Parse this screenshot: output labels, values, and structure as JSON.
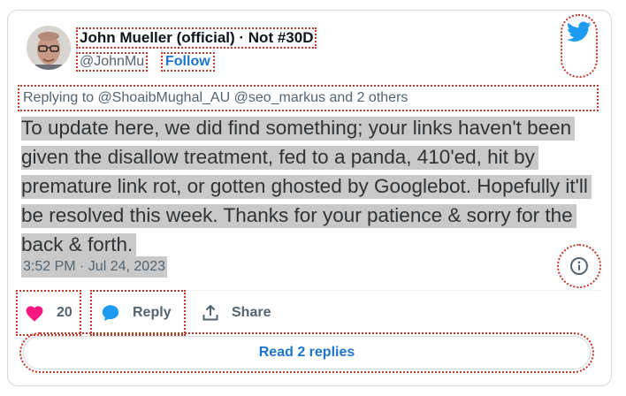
{
  "tweet": {
    "author_name": "John Mueller (official) · Not #30D",
    "handle": "@JohnMu",
    "follow_label": "Follow",
    "replying_to": "Replying to @ShoaibMughal_AU @seo_markus and 2 others",
    "text": "To update here, we did find something; your links haven't been given the disallow treatment, fed to a panda, 410'ed, hit by premature link rot, or gotten ghosted by Googlebot. Hopefully it'll be resolved this week. Thanks for your patience & sorry for the back & forth.",
    "timestamp": "3:52 PM · Jul 24, 2023"
  },
  "actions": {
    "like_count": "20",
    "reply_label": "Reply",
    "share_label": "Share",
    "read_replies_label": "Read 2 replies"
  },
  "icons": {
    "brand": "twitter-bird-icon",
    "info": "info-icon",
    "like": "heart-icon",
    "reply": "speech-bubble-icon",
    "share": "share-upload-icon"
  },
  "colors": {
    "twitter_blue": "#1d9bf0",
    "link_blue": "#1d74d0",
    "like_pink": "#f91880",
    "muted_text": "#536471",
    "annotation_red": "#c0392b"
  }
}
